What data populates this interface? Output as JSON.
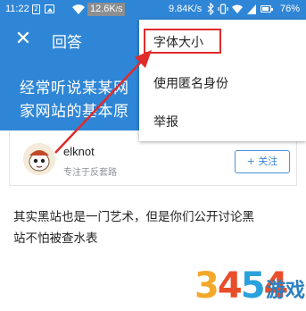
{
  "status_bar": {
    "time": "11:22",
    "sim_label": "2",
    "speed_badge_value": "12.6K",
    "speed_badge_unit": "/S",
    "net_rate": "9.84K/s",
    "battery_percent": "76%"
  },
  "header": {
    "close_icon_glyph": "✕",
    "title": "回答"
  },
  "question": {
    "line1": "经常听说某某网",
    "line2": "家网站的基本原"
  },
  "author": {
    "name": "elknot",
    "bio": "专注于反套路",
    "follow_label": "+ 关注"
  },
  "body": {
    "line1": "其实黑站也是一门艺术，但是你们公开讨论黑",
    "line2": "站不怕被查水表"
  },
  "menu": {
    "items": [
      {
        "label": "字体大小",
        "highlighted": true
      },
      {
        "label": "使用匿名身份",
        "highlighted": false
      },
      {
        "label": "举报",
        "highlighted": false
      }
    ]
  },
  "colors": {
    "brand_blue": "#2f86d6",
    "annotation_red": "#e02b2b"
  },
  "watermark": {
    "digits": [
      "3",
      "4",
      "5",
      "4"
    ],
    "text": "游戏"
  }
}
